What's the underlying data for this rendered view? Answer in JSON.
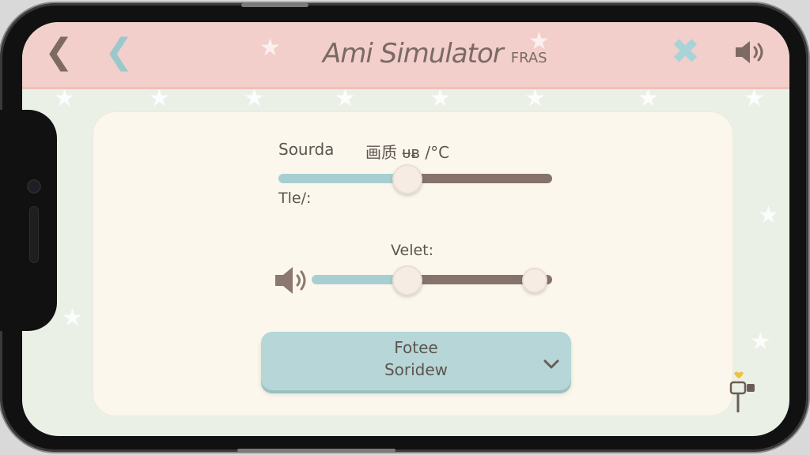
{
  "header": {
    "title": "Ami Simulator",
    "title_suffix": "FRAS",
    "back_icon": "chevron-left-icon",
    "back_alt_icon": "chevron-left-icon",
    "close_icon": "close-icon",
    "sound_icon": "speaker-icon"
  },
  "panel": {
    "source_label": "Sourda",
    "quality_label": "画质 ᵾᴃ /°C",
    "tie_label": "Tle/:",
    "velet_label": "Velet:",
    "slider1_level": 0.46,
    "slider2_level_low": 0.38,
    "slider2_level_high": 0.94
  },
  "dropdown": {
    "line1": "Fotee",
    "line2": "Soridew"
  },
  "colors": {
    "header_bg": "#f3cfcb",
    "accent_blue": "#a7cfd2",
    "accent_brown": "#86736b",
    "panel_bg": "#fbf7ec"
  }
}
